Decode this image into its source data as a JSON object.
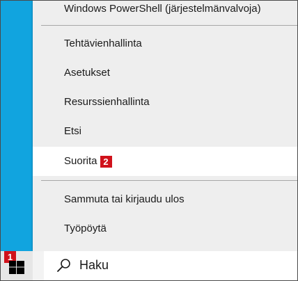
{
  "menu": {
    "items_top": [
      {
        "label": "Windows PowerShell (järjestelmänvalvoja)"
      }
    ],
    "items_mid": [
      {
        "label": "Tehtävienhallinta"
      },
      {
        "label": "Asetukset"
      },
      {
        "label": "Resurssienhallinta"
      },
      {
        "label": "Etsi"
      },
      {
        "label": "Suorita",
        "badge": "2",
        "highlighted": true
      }
    ],
    "items_bottom": [
      {
        "label": "Sammuta tai kirjaudu ulos"
      },
      {
        "label": "Työpöytä"
      }
    ]
  },
  "taskbar": {
    "start_badge": "1",
    "search_text": "Haku"
  },
  "colors": {
    "accent": "#11a4df",
    "badge": "#d0121b",
    "menu_background": "#eeeeee"
  },
  "icons": {
    "start": "windows-logo-icon",
    "search": "search-icon"
  }
}
